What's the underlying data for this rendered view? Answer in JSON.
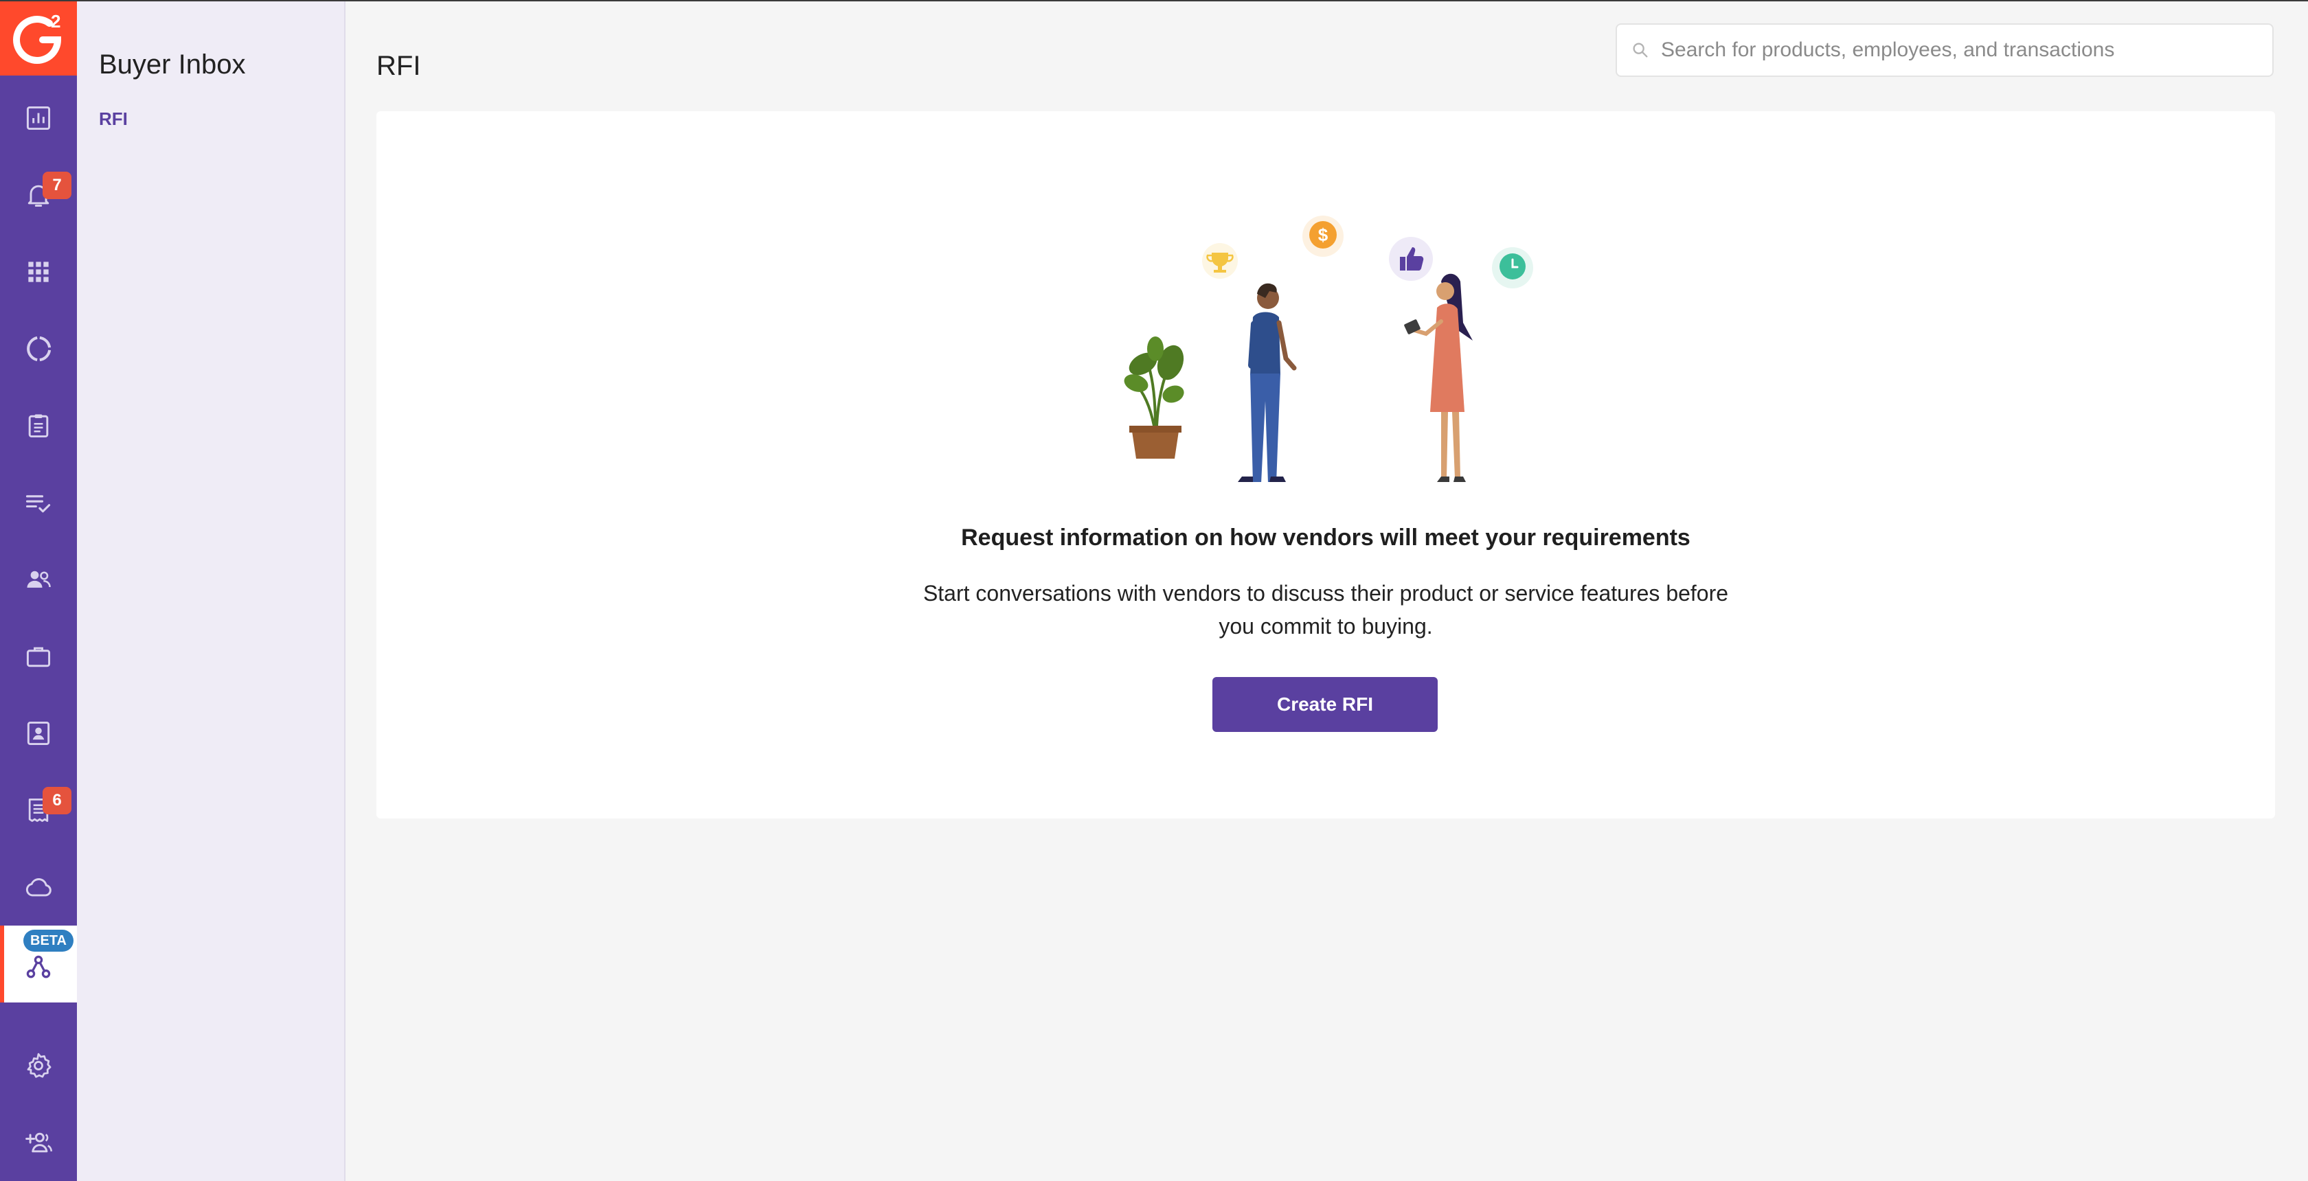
{
  "colors": {
    "rail": "#5a40a0",
    "brand_orange": "#ff492c",
    "badge": "#e5533d",
    "beta": "#2f7fc1",
    "subnav_bg": "#efecf6",
    "page_bg": "#f5f5f5",
    "primary_button": "#5a40a0"
  },
  "logo": {
    "text": "2"
  },
  "rail": {
    "items": [
      {
        "icon": "bar-chart-icon"
      },
      {
        "icon": "bell-icon",
        "badge": "7"
      },
      {
        "icon": "grid-icon"
      },
      {
        "icon": "donut-chart-icon"
      },
      {
        "icon": "clipboard-icon"
      },
      {
        "icon": "checklist-icon"
      },
      {
        "icon": "people-icon"
      },
      {
        "icon": "briefcase-icon"
      },
      {
        "icon": "contact-card-icon"
      },
      {
        "icon": "receipt-icon",
        "badge": "6"
      },
      {
        "icon": "cloud-icon"
      },
      {
        "icon": "network-icon",
        "beta": "BETA",
        "active": true
      },
      {
        "icon": "gear-icon"
      },
      {
        "icon": "add-user-icon"
      }
    ]
  },
  "subnav": {
    "title": "Buyer Inbox",
    "links": [
      {
        "label": "RFI",
        "active": true
      }
    ]
  },
  "header": {
    "title": "RFI",
    "search": {
      "placeholder": "Search for products, employees, and transactions",
      "value": ""
    }
  },
  "empty_state": {
    "headline": "Request information on how vendors will meet your requirements",
    "description": "Start conversations with vendors to discuss their product or service features before you commit to buying.",
    "button_label": "Create RFI",
    "illustration": {
      "bubbles": [
        "trophy-icon",
        "dollar-icon",
        "thumbs-up-icon",
        "clock-icon"
      ]
    }
  }
}
